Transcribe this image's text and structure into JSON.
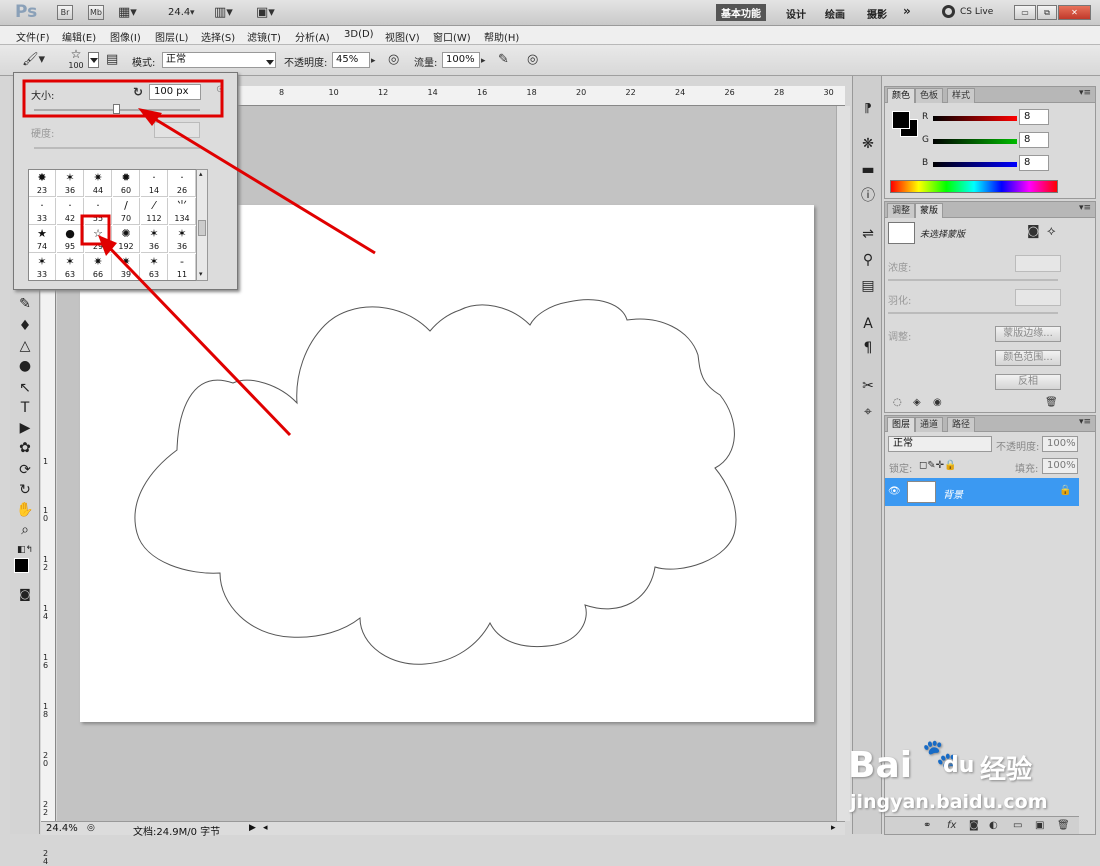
{
  "appbar": {
    "logo": "Ps",
    "br": "Br",
    "mb": "Mb",
    "zoom": "24.4",
    "ws_basic": "基本功能",
    "ws_design": "设计",
    "ws_paint": "绘画",
    "ws_photo": "摄影",
    "ws_more": "»",
    "cslive": "CS Live"
  },
  "menu": [
    "文件(F)",
    "编辑(E)",
    "图像(I)",
    "图层(L)",
    "选择(S)",
    "滤镜(T)",
    "分析(A)",
    "3D(D)",
    "视图(V)",
    "窗口(W)",
    "帮助(H)"
  ],
  "options": {
    "brush_size": "100",
    "mode_label": "模式:",
    "mode_value": "正常",
    "opacity_label": "不透明度:",
    "opacity_value": "45%",
    "flow_label": "流量:",
    "flow_value": "100%"
  },
  "brush_popup": {
    "size_label": "大小:",
    "size_value": "100 px",
    "hardness_label": "硬度:",
    "rows": [
      [
        "23",
        "36",
        "44",
        "60",
        "14",
        "26"
      ],
      [
        "33",
        "42",
        "55",
        "70",
        "112",
        "134"
      ],
      [
        "74",
        "95",
        "29",
        "192",
        "36",
        "36"
      ],
      [
        "33",
        "63",
        "66",
        "39",
        "63",
        "11"
      ]
    ]
  },
  "ruler_top": [
    "8",
    "10",
    "12",
    "14",
    "16",
    "18",
    "20",
    "22",
    "24",
    "26",
    "28",
    "30"
  ],
  "ruler_left": [
    "1",
    "1 0",
    "1 2",
    "1 4",
    "1 6",
    "1 8",
    "2 0",
    "2 2",
    "2 4"
  ],
  "status": {
    "zoom": "24.4%",
    "doc": "文档:24.9M/0 字节"
  },
  "color_panel": {
    "tabs": [
      "颜色",
      "色板",
      "样式"
    ],
    "r_label": "R",
    "g_label": "G",
    "b_label": "B",
    "r": "8",
    "g": "8",
    "b": "8"
  },
  "masks_panel": {
    "tabs": [
      "调整",
      "蒙版"
    ],
    "no_mask": "未选择蒙版",
    "density": "浓度:",
    "feather": "羽化:",
    "refine": "调整:",
    "edge_btn": "蒙版边缘...",
    "range_btn": "颜色范围...",
    "invert_btn": "反相"
  },
  "layers_panel": {
    "tabs": [
      "图层",
      "通道",
      "路径"
    ],
    "blend": "正常",
    "opacity_label": "不透明度:",
    "opacity_value": "100%",
    "lock_label": "锁定:",
    "fill_label": "填充:",
    "fill_value": "100%",
    "layer_name": "背景"
  },
  "watermark": {
    "line1": "Bai",
    "line2": "du",
    "line3": "经验",
    "url": "jingyan.baidu.com"
  },
  "colors": {
    "annotation": "#e00000",
    "layer_selected": "#3b99f2"
  }
}
